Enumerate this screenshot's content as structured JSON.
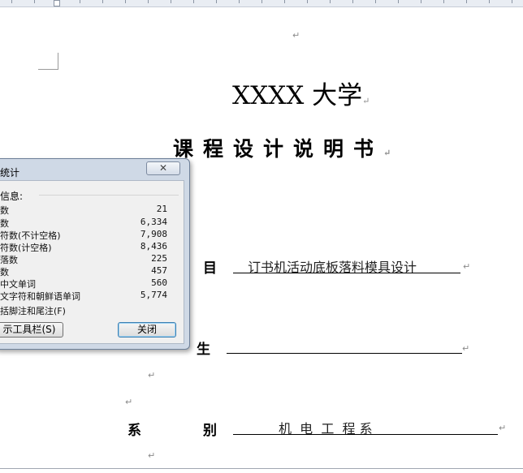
{
  "document": {
    "title": "XXXX 大学",
    "subtitle": "课程设计说明书",
    "fields": {
      "topic_label_char": "目",
      "topic_value": "订书机活动底板落料模具设计",
      "student_label_char": "生",
      "department_label_first": "系",
      "department_label_last": "别",
      "department_value": "机  电  工  程 系"
    },
    "paragraph_mark": "↵"
  },
  "dialog": {
    "title": "统计",
    "close_glyph": "✕",
    "info_header": "信息:",
    "stats": [
      {
        "label": "数",
        "value": "21"
      },
      {
        "label": "数",
        "value": "6,334"
      },
      {
        "label": "符数(不计空格)",
        "value": "7,908"
      },
      {
        "label": "符数(计空格)",
        "value": "8,436"
      },
      {
        "label": "落数",
        "value": "225"
      },
      {
        "label": "数",
        "value": "457"
      },
      {
        "label": "中文单词",
        "value": "560"
      },
      {
        "label": "文字符和朝鲜语单词",
        "value": "5,774"
      }
    ],
    "include_footnotes_label": "括脚注和尾注(F)",
    "toolbar_button_label": "示工具栏(S)",
    "close_button_label": "关闭"
  }
}
